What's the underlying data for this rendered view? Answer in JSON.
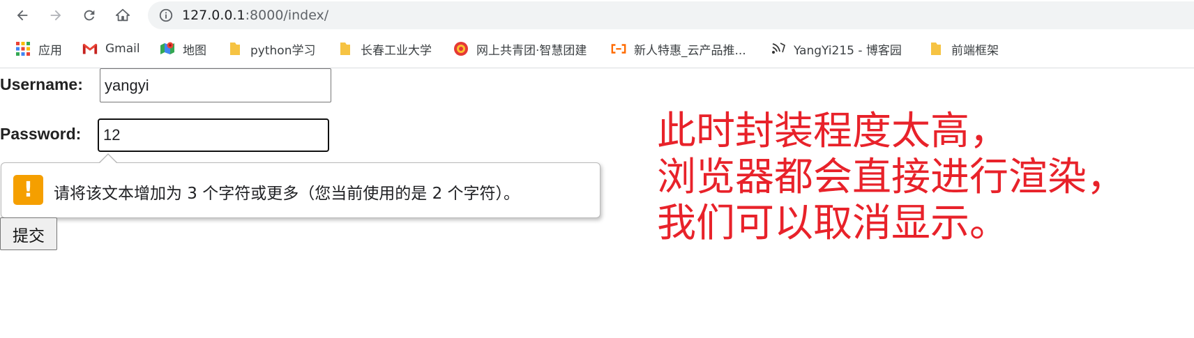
{
  "browser": {
    "url_host": "127.0.0.1",
    "url_rest": ":8000/index/"
  },
  "bookmarks": [
    {
      "label": "应用",
      "icon": "apps-grid-icon"
    },
    {
      "label": "Gmail",
      "icon": "gmail-icon"
    },
    {
      "label": "地图",
      "icon": "maps-icon"
    },
    {
      "label": "python学习",
      "icon": "folder-icon"
    },
    {
      "label": "长春工业大学",
      "icon": "folder-icon"
    },
    {
      "label": "网上共青团·智慧团建",
      "icon": "youth-league-icon"
    },
    {
      "label": "新人特惠_云产品推...",
      "icon": "aliyun-icon"
    },
    {
      "label": "YangYi215 - 博客园",
      "icon": "cnblogs-icon"
    },
    {
      "label": "前端框架",
      "icon": "folder-icon"
    }
  ],
  "form": {
    "username_label": "Username:",
    "username_value": "yangyi",
    "password_label": "Password:",
    "password_value": "12",
    "submit_label": "提交"
  },
  "validation": {
    "message": "请将该文本增加为 3 个字符或更多（您当前使用的是 2 个字符）。",
    "icon": "warning-icon",
    "icon_glyph": "!"
  },
  "annotation": {
    "lines": [
      "此时封装程度太高，",
      "浏览器都会直接进行渲染，",
      "我们可以取消显示。"
    ]
  },
  "colors": {
    "annotation": "#e8222a",
    "warning": "#f59f00",
    "folder": "#f6c343"
  }
}
